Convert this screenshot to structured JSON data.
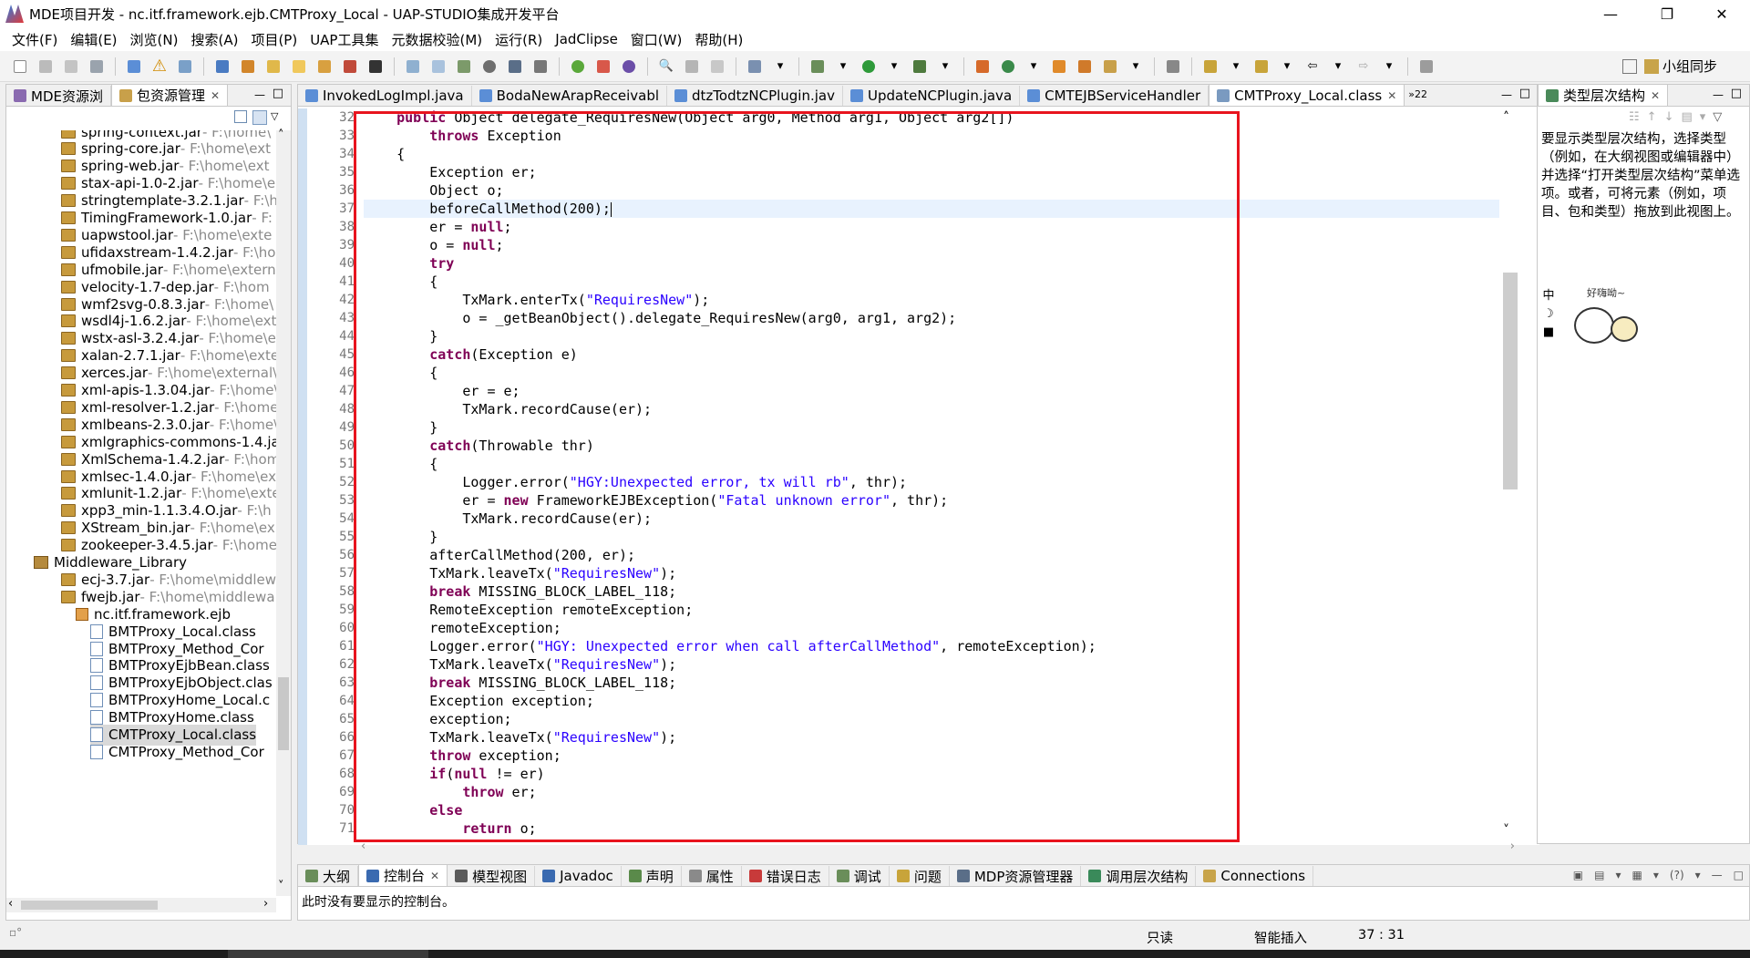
{
  "window": {
    "title": "MDE项目开发 - nc.itf.framework.ejb.CMTProxy_Local - UAP-STUDIO集成开发平台",
    "minimize_icon": "minimize-icon",
    "maximize_icon": "maximize-icon",
    "close_icon": "close-icon"
  },
  "menubar": {
    "items": [
      "文件(F)",
      "编辑(E)",
      "浏览(N)",
      "搜索(A)",
      "项目(P)",
      "UAP工具集",
      "元数据校验(M)",
      "运行(R)",
      "JadClipse",
      "窗口(W)",
      "帮助(H)"
    ]
  },
  "toolbar": {
    "team_sync": "小组同步"
  },
  "left_panel": {
    "tabs": [
      {
        "label": "MDE资源浏"
      },
      {
        "label": "包资源管理"
      }
    ],
    "tree": [
      {
        "name": "spring-context.jar",
        "path": " - F:\\home\\",
        "type": "jar"
      },
      {
        "name": "spring-core.jar",
        "path": " - F:\\home\\ext",
        "type": "jar"
      },
      {
        "name": "spring-web.jar",
        "path": " - F:\\home\\ext",
        "type": "jar"
      },
      {
        "name": "stax-api-1.0-2.jar",
        "path": " - F:\\home\\e",
        "type": "jar"
      },
      {
        "name": "stringtemplate-3.2.1.jar",
        "path": " - F:\\h",
        "type": "jar"
      },
      {
        "name": "TimingFramework-1.0.jar",
        "path": " - F:",
        "type": "jar"
      },
      {
        "name": "uapwstool.jar",
        "path": " - F:\\home\\exte",
        "type": "jar"
      },
      {
        "name": "ufidaxstream-1.4.2.jar",
        "path": " - F:\\ho",
        "type": "jar"
      },
      {
        "name": "ufmobile.jar",
        "path": " - F:\\home\\extern",
        "type": "jar"
      },
      {
        "name": "velocity-1.7-dep.jar",
        "path": " - F:\\hom",
        "type": "jar"
      },
      {
        "name": "wmf2svg-0.8.3.jar",
        "path": " - F:\\home\\",
        "type": "jar"
      },
      {
        "name": "wsdl4j-1.6.2.jar",
        "path": " - F:\\home\\ext",
        "type": "jar"
      },
      {
        "name": "wstx-asl-3.2.4.jar",
        "path": " - F:\\home\\e",
        "type": "jar"
      },
      {
        "name": "xalan-2.7.1.jar",
        "path": " - F:\\home\\exte",
        "type": "jar"
      },
      {
        "name": "xerces.jar",
        "path": " - F:\\home\\external\\",
        "type": "jar"
      },
      {
        "name": "xml-apis-1.3.04.jar",
        "path": " - F:\\home\\",
        "type": "jar"
      },
      {
        "name": "xml-resolver-1.2.jar",
        "path": " - F:\\home",
        "type": "jar"
      },
      {
        "name": "xmlbeans-2.3.0.jar",
        "path": " - F:\\home\\",
        "type": "jar"
      },
      {
        "name": "xmlgraphics-commons-1.4.ja",
        "path": "",
        "type": "jar"
      },
      {
        "name": "XmlSchema-1.4.2.jar",
        "path": " - F:\\hom",
        "type": "jar"
      },
      {
        "name": "xmlsec-1.4.0.jar",
        "path": " - F:\\home\\ex",
        "type": "jar"
      },
      {
        "name": "xmlunit-1.2.jar",
        "path": " - F:\\home\\exte",
        "type": "jar"
      },
      {
        "name": "xpp3_min-1.1.3.4.O.jar",
        "path": " - F:\\h",
        "type": "jar"
      },
      {
        "name": "XStream_bin.jar",
        "path": " - F:\\home\\ex",
        "type": "jar"
      },
      {
        "name": "zookeeper-3.4.5.jar",
        "path": " - F:\\home",
        "type": "jar"
      },
      {
        "name": "Middleware_Library",
        "path": "",
        "type": "lib"
      },
      {
        "name": "ecj-3.7.jar",
        "path": " - F:\\home\\middlew",
        "type": "jar"
      },
      {
        "name": "fwejb.jar",
        "path": " - F:\\home\\middlewa",
        "type": "jar"
      },
      {
        "name": "nc.itf.framework.ejb",
        "path": "",
        "type": "pkg"
      },
      {
        "name": "BMTProxy_Local.class",
        "path": "",
        "type": "class"
      },
      {
        "name": "BMTProxy_Method_Cor",
        "path": "",
        "type": "class"
      },
      {
        "name": "BMTProxyEjbBean.class",
        "path": "",
        "type": "class"
      },
      {
        "name": "BMTProxyEjbObject.clas",
        "path": "",
        "type": "class"
      },
      {
        "name": "BMTProxyHome_Local.c",
        "path": "",
        "type": "class"
      },
      {
        "name": "BMTProxyHome.class",
        "path": "",
        "type": "class"
      },
      {
        "name": "CMTProxy_Local.class",
        "path": "",
        "type": "class",
        "selected": true
      },
      {
        "name": "CMTProxy_Method_Cor",
        "path": "",
        "type": "class"
      }
    ]
  },
  "editor": {
    "tabs": [
      {
        "label": "InvokedLogImpl.java"
      },
      {
        "label": "BodaNewArapReceivabl"
      },
      {
        "label": "dtzTodtzNCPlugin.jav"
      },
      {
        "label": "UpdateNCPlugin.java"
      },
      {
        "label": "CMTEJBServiceHandler"
      },
      {
        "label": "CMTProxy_Local.class",
        "active": true
      }
    ],
    "overflow_count": "»22",
    "lines": [
      {
        "n": "32",
        "tokens": [
          [
            "    ",
            ""
          ],
          [
            "public",
            "kw"
          ],
          [
            " Object delegate_RequiresNew(Object arg0, Method arg1, Object arg2[])",
            ""
          ]
        ]
      },
      {
        "n": "33",
        "tokens": [
          [
            "        ",
            ""
          ],
          [
            "throws",
            "kw"
          ],
          [
            " Exception",
            ""
          ]
        ]
      },
      {
        "n": "34",
        "tokens": [
          [
            "    {",
            ""
          ]
        ]
      },
      {
        "n": "35",
        "tokens": [
          [
            "        Exception er;",
            ""
          ]
        ]
      },
      {
        "n": "36",
        "tokens": [
          [
            "        Object o;",
            ""
          ]
        ]
      },
      {
        "n": "37",
        "tokens": [
          [
            "        beforeCallMethod(200);",
            ""
          ]
        ],
        "current": true
      },
      {
        "n": "38",
        "tokens": [
          [
            "        er = ",
            ""
          ],
          [
            "null",
            "kw"
          ],
          [
            ";",
            ""
          ]
        ]
      },
      {
        "n": "39",
        "tokens": [
          [
            "        o = ",
            ""
          ],
          [
            "null",
            "kw"
          ],
          [
            ";",
            ""
          ]
        ]
      },
      {
        "n": "40",
        "tokens": [
          [
            "        ",
            ""
          ],
          [
            "try",
            "kw"
          ]
        ]
      },
      {
        "n": "41",
        "tokens": [
          [
            "        {",
            ""
          ]
        ]
      },
      {
        "n": "42",
        "tokens": [
          [
            "            TxMark.enterTx(",
            ""
          ],
          [
            "\"RequiresNew\"",
            "str"
          ],
          [
            ");",
            ""
          ]
        ]
      },
      {
        "n": "43",
        "tokens": [
          [
            "            o = _getBeanObject().delegate_RequiresNew(arg0, arg1, arg2);",
            ""
          ]
        ]
      },
      {
        "n": "44",
        "tokens": [
          [
            "        }",
            ""
          ]
        ]
      },
      {
        "n": "45",
        "tokens": [
          [
            "        ",
            ""
          ],
          [
            "catch",
            "kw"
          ],
          [
            "(Exception e)",
            ""
          ]
        ]
      },
      {
        "n": "46",
        "tokens": [
          [
            "        {",
            ""
          ]
        ]
      },
      {
        "n": "47",
        "tokens": [
          [
            "            er = e;",
            ""
          ]
        ]
      },
      {
        "n": "48",
        "tokens": [
          [
            "            TxMark.recordCause(er);",
            ""
          ]
        ]
      },
      {
        "n": "49",
        "tokens": [
          [
            "        }",
            ""
          ]
        ]
      },
      {
        "n": "50",
        "tokens": [
          [
            "        ",
            ""
          ],
          [
            "catch",
            "kw"
          ],
          [
            "(Throwable thr)",
            ""
          ]
        ]
      },
      {
        "n": "51",
        "tokens": [
          [
            "        {",
            ""
          ]
        ]
      },
      {
        "n": "52",
        "tokens": [
          [
            "            Logger.error(",
            ""
          ],
          [
            "\"HGY:Unexpected error, tx will rb\"",
            "str"
          ],
          [
            ", thr);",
            ""
          ]
        ]
      },
      {
        "n": "53",
        "tokens": [
          [
            "            er = ",
            ""
          ],
          [
            "new",
            "kw"
          ],
          [
            " FrameworkEJBException(",
            ""
          ],
          [
            "\"Fatal unknown error\"",
            "str"
          ],
          [
            ", thr);",
            ""
          ]
        ]
      },
      {
        "n": "54",
        "tokens": [
          [
            "            TxMark.recordCause(er);",
            ""
          ]
        ]
      },
      {
        "n": "55",
        "tokens": [
          [
            "        }",
            ""
          ]
        ]
      },
      {
        "n": "56",
        "tokens": [
          [
            "        afterCallMethod(200, er);",
            ""
          ]
        ]
      },
      {
        "n": "57",
        "tokens": [
          [
            "        TxMark.leaveTx(",
            ""
          ],
          [
            "\"RequiresNew\"",
            "str"
          ],
          [
            ");",
            ""
          ]
        ]
      },
      {
        "n": "58",
        "tokens": [
          [
            "        ",
            ""
          ],
          [
            "break",
            "kw"
          ],
          [
            " MISSING_BLOCK_LABEL_118;",
            ""
          ]
        ]
      },
      {
        "n": "59",
        "tokens": [
          [
            "        RemoteException remoteException;",
            ""
          ]
        ]
      },
      {
        "n": "60",
        "tokens": [
          [
            "        remoteException;",
            ""
          ]
        ]
      },
      {
        "n": "61",
        "tokens": [
          [
            "        Logger.error(",
            ""
          ],
          [
            "\"HGY: Unexpected error when call afterCallMethod\"",
            "str"
          ],
          [
            ", remoteException);",
            ""
          ]
        ]
      },
      {
        "n": "62",
        "tokens": [
          [
            "        TxMark.leaveTx(",
            ""
          ],
          [
            "\"RequiresNew\"",
            "str"
          ],
          [
            ");",
            ""
          ]
        ]
      },
      {
        "n": "63",
        "tokens": [
          [
            "        ",
            ""
          ],
          [
            "break",
            "kw"
          ],
          [
            " MISSING_BLOCK_LABEL_118;",
            ""
          ]
        ]
      },
      {
        "n": "64",
        "tokens": [
          [
            "        Exception exception;",
            ""
          ]
        ]
      },
      {
        "n": "65",
        "tokens": [
          [
            "        exception;",
            ""
          ]
        ]
      },
      {
        "n": "66",
        "tokens": [
          [
            "        TxMark.leaveTx(",
            ""
          ],
          [
            "\"RequiresNew\"",
            "str"
          ],
          [
            ");",
            ""
          ]
        ]
      },
      {
        "n": "67",
        "tokens": [
          [
            "        ",
            ""
          ],
          [
            "throw",
            "kw"
          ],
          [
            " exception;",
            ""
          ]
        ]
      },
      {
        "n": "68",
        "tokens": [
          [
            "        ",
            ""
          ],
          [
            "if",
            "kw"
          ],
          [
            "(",
            ""
          ],
          [
            "null",
            "kw"
          ],
          [
            " != er)",
            ""
          ]
        ]
      },
      {
        "n": "69",
        "tokens": [
          [
            "            ",
            ""
          ],
          [
            "throw",
            "kw"
          ],
          [
            " er;",
            ""
          ]
        ]
      },
      {
        "n": "70",
        "tokens": [
          [
            "        ",
            ""
          ],
          [
            "else",
            "kw"
          ]
        ]
      },
      {
        "n": "71",
        "tokens": [
          [
            "            ",
            ""
          ],
          [
            "return",
            "kw"
          ],
          [
            " o;",
            ""
          ]
        ]
      }
    ]
  },
  "right_panel": {
    "tab": "类型层次结构",
    "hint": "要显示类型层次结构，选择类型（例如，在大纲视图或编辑器中）并选择“打开类型层次结构”菜单选项。或者，可将元素（例如，项目、包和类型）拖放到此视图上。",
    "sticker_text": "好嗨呦~",
    "ime_label": "中"
  },
  "bottom_panel": {
    "tabs": [
      {
        "label": "大纲"
      },
      {
        "label": "控制台",
        "active": true
      },
      {
        "label": "模型视图"
      },
      {
        "label": "Javadoc"
      },
      {
        "label": "声明"
      },
      {
        "label": "属性"
      },
      {
        "label": "错误日志"
      },
      {
        "label": "调试"
      },
      {
        "label": "问题"
      },
      {
        "label": "MDP资源管理器"
      },
      {
        "label": "调用层次结构"
      },
      {
        "label": "Connections"
      }
    ],
    "console_message": "此时没有要显示的控制台。"
  },
  "statusbar": {
    "mode": "只读",
    "insert": "智能插入",
    "position": "37 : 31"
  },
  "colors": {
    "highlight_box": "#e8141e",
    "keyword": "#7f0055",
    "string": "#2a00ff",
    "current_line": "#e8f2fe"
  }
}
